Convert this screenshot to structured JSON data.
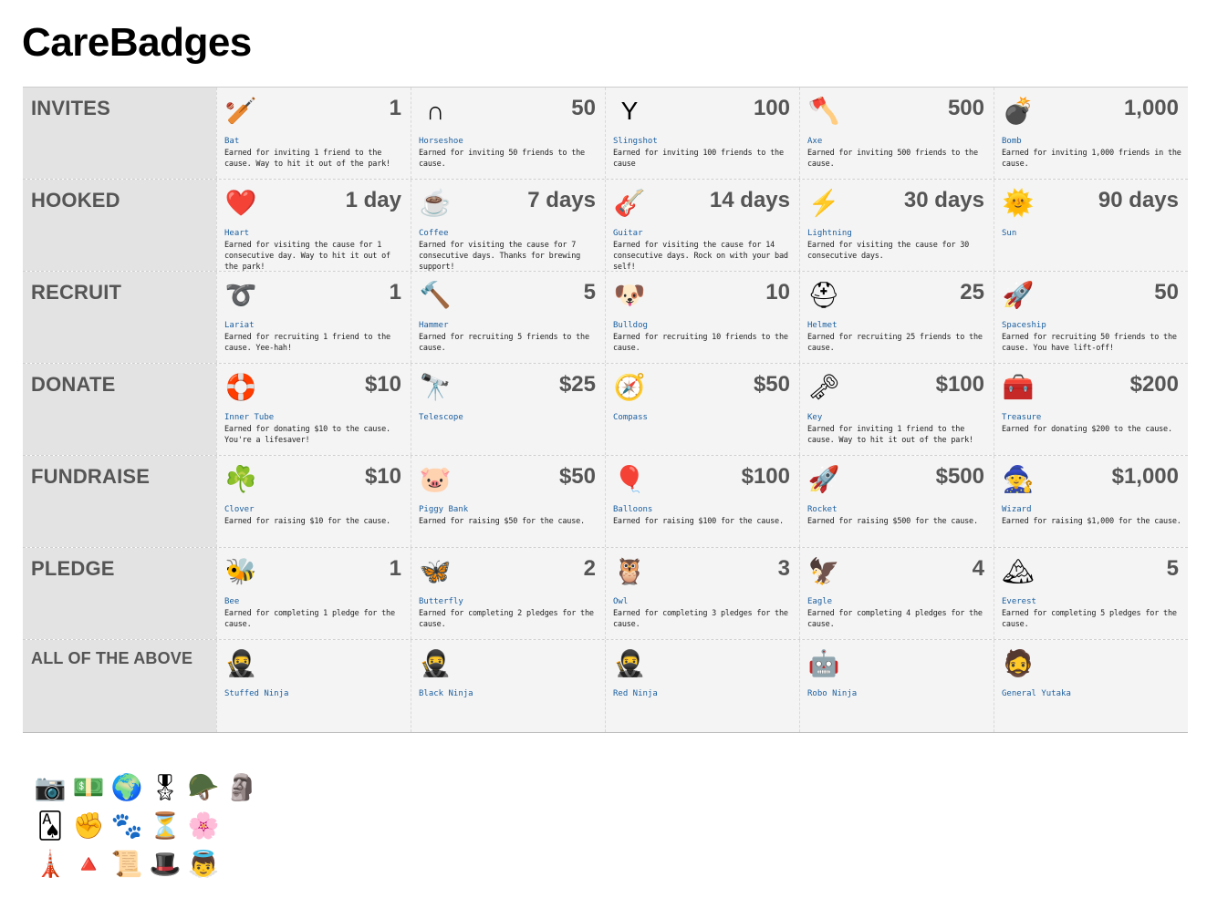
{
  "title": "CareBadges",
  "rows": [
    {
      "category": "INVITES",
      "cells": [
        {
          "icon": "bat-icon",
          "glyph": "🏏",
          "value": "1",
          "name": "Bat",
          "desc": "Earned for inviting 1 friend to the cause. Way to hit it out of the park!"
        },
        {
          "icon": "horseshoe-icon",
          "glyph": "∩",
          "value": "50",
          "name": "Horseshoe",
          "desc": "Earned for inviting 50 friends to the cause."
        },
        {
          "icon": "slingshot-icon",
          "glyph": "Y",
          "value": "100",
          "name": "Slingshot",
          "desc": "Earned for inviting 100 friends to the cause"
        },
        {
          "icon": "axe-icon",
          "glyph": "🪓",
          "value": "500",
          "name": "Axe",
          "desc": "Earned for inviting 500 friends to the cause."
        },
        {
          "icon": "bomb-icon",
          "glyph": "💣",
          "value": "1,000",
          "name": "Bomb",
          "desc": "Earned for inviting 1,000 friends in the cause."
        }
      ]
    },
    {
      "category": "HOOKED",
      "cells": [
        {
          "icon": "heart-icon",
          "glyph": "❤️",
          "value": "1 day",
          "name": "Heart",
          "desc": "Earned for visiting the cause for 1 consecutive day. Way to hit it out of the park!"
        },
        {
          "icon": "coffee-icon",
          "glyph": "☕",
          "value": "7 days",
          "name": "Coffee",
          "desc": "Earned for visiting the cause for 7 consecutive days. Thanks for brewing support!"
        },
        {
          "icon": "guitar-icon",
          "glyph": "🎸",
          "value": "14 days",
          "name": "Guitar",
          "desc": "Earned for visiting the cause for 14 consecutive days. Rock on with your bad self!"
        },
        {
          "icon": "lightning-icon",
          "glyph": "⚡",
          "value": "30 days",
          "name": "Lightning",
          "desc": "Earned for visiting the cause for 30 consecutive days."
        },
        {
          "icon": "sun-icon",
          "glyph": "🌞",
          "value": "90 days",
          "name": "Sun",
          "desc": ""
        }
      ]
    },
    {
      "category": "RECRUIT",
      "cells": [
        {
          "icon": "lariat-icon",
          "glyph": "➰",
          "value": "1",
          "name": "Lariat",
          "desc": "Earned for recruiting 1 friend to the cause. Yee-hah!"
        },
        {
          "icon": "hammer-icon",
          "glyph": "🔨",
          "value": "5",
          "name": "Hammer",
          "desc": "Earned for recruiting 5 friends to the cause."
        },
        {
          "icon": "bulldog-icon",
          "glyph": "🐶",
          "value": "10",
          "name": "Bulldog",
          "desc": "Earned for recruiting 10 friends to the cause."
        },
        {
          "icon": "helmet-icon",
          "glyph": "⛑",
          "value": "25",
          "name": "Helmet",
          "desc": "Earned for recruiting 25 friends to the cause."
        },
        {
          "icon": "spaceship-icon",
          "glyph": "🚀",
          "value": "50",
          "name": "Spaceship",
          "desc": "Earned for recruiting 50 friends to the cause. You have lift-off!"
        }
      ]
    },
    {
      "category": "DONATE",
      "cells": [
        {
          "icon": "inner-tube-icon",
          "glyph": "🛟",
          "value": "$10",
          "name": "Inner Tube",
          "desc": "Earned for donating $10 to the cause. You're a lifesaver!"
        },
        {
          "icon": "telescope-icon",
          "glyph": "🔭",
          "value": "$25",
          "name": "Telescope",
          "desc": ""
        },
        {
          "icon": "compass-icon",
          "glyph": "🧭",
          "value": "$50",
          "name": "Compass",
          "desc": ""
        },
        {
          "icon": "key-icon",
          "glyph": "🗝",
          "value": "$100",
          "name": "Key",
          "desc": "Earned for inviting 1 friend to the cause. Way to hit it out of the park!"
        },
        {
          "icon": "treasure-icon",
          "glyph": "🧰",
          "value": "$200",
          "name": "Treasure",
          "desc": "Earned for donating $200 to the cause."
        }
      ]
    },
    {
      "category": "FUNDRAISE",
      "cells": [
        {
          "icon": "clover-icon",
          "glyph": "☘️",
          "value": "$10",
          "name": "Clover",
          "desc": "Earned for raising $10 for the cause."
        },
        {
          "icon": "piggy-bank-icon",
          "glyph": "🐷",
          "value": "$50",
          "name": "Piggy Bank",
          "desc": "Earned for raising $50 for the cause."
        },
        {
          "icon": "balloons-icon",
          "glyph": "🎈",
          "value": "$100",
          "name": "Balloons",
          "desc": "Earned for raising $100 for the cause."
        },
        {
          "icon": "rocket-icon",
          "glyph": "🚀",
          "value": "$500",
          "name": "Rocket",
          "desc": "Earned for raising $500 for the cause."
        },
        {
          "icon": "wizard-icon",
          "glyph": "🧙",
          "value": "$1,000",
          "name": "Wizard",
          "desc": "Earned for raising $1,000 for the cause."
        }
      ]
    },
    {
      "category": "PLEDGE",
      "cells": [
        {
          "icon": "bee-icon",
          "glyph": "🐝",
          "value": "1",
          "name": "Bee",
          "desc": "Earned for completing 1 pledge for the cause."
        },
        {
          "icon": "butterfly-icon",
          "glyph": "🦋",
          "value": "2",
          "name": "Butterfly",
          "desc": "Earned for completing 2 pledges for the cause."
        },
        {
          "icon": "owl-icon",
          "glyph": "🦉",
          "value": "3",
          "name": "Owl",
          "desc": "Earned for completing 3 pledges for the cause."
        },
        {
          "icon": "eagle-icon",
          "glyph": "🦅",
          "value": "4",
          "name": "Eagle",
          "desc": "Earned for completing 4 pledges for the cause."
        },
        {
          "icon": "everest-icon",
          "glyph": "🏔",
          "value": "5",
          "name": "Everest",
          "desc": "Earned for completing 5 pledges for the cause."
        }
      ]
    },
    {
      "category": "ALL OF THE ABOVE",
      "cells": [
        {
          "icon": "stuffed-ninja-icon",
          "glyph": "🥷",
          "value": "",
          "name": "Stuffed Ninja",
          "desc": ""
        },
        {
          "icon": "black-ninja-icon",
          "glyph": "🥷",
          "value": "",
          "name": "Black Ninja",
          "desc": ""
        },
        {
          "icon": "red-ninja-icon",
          "glyph": "🥷",
          "value": "",
          "name": "Red Ninja",
          "desc": ""
        },
        {
          "icon": "robo-ninja-icon",
          "glyph": "🤖",
          "value": "",
          "name": "Robo Ninja",
          "desc": ""
        },
        {
          "icon": "general-yutaka-icon",
          "glyph": "🧔",
          "value": "",
          "name": "General Yutaka",
          "desc": ""
        }
      ]
    }
  ],
  "extras": [
    [
      {
        "icon": "camera-icon",
        "glyph": "📷"
      },
      {
        "icon": "money-stack-icon",
        "glyph": "💵"
      },
      {
        "icon": "globe-icon",
        "glyph": "🌍"
      },
      {
        "icon": "medal-icon",
        "glyph": "🎖"
      },
      {
        "icon": "soldier-icon",
        "glyph": "🪖"
      },
      {
        "icon": "pharaoh-icon",
        "glyph": "🗿"
      }
    ],
    [
      {
        "icon": "spade-card-icon",
        "glyph": "🂡"
      },
      {
        "icon": "fist-icon",
        "glyph": "✊"
      },
      {
        "icon": "paw-icon",
        "glyph": "🐾"
      },
      {
        "icon": "hourglass-icon",
        "glyph": "⏳"
      },
      {
        "icon": "flower-icon",
        "glyph": "🌸"
      }
    ],
    [
      {
        "icon": "monument-icon",
        "glyph": "🗼"
      },
      {
        "icon": "pyramid-icon",
        "glyph": "🔺"
      },
      {
        "icon": "scroll-icon",
        "glyph": "📜"
      },
      {
        "icon": "pilgrim-icon",
        "glyph": "🎩"
      },
      {
        "icon": "angel-icon",
        "glyph": "👼"
      }
    ]
  ]
}
